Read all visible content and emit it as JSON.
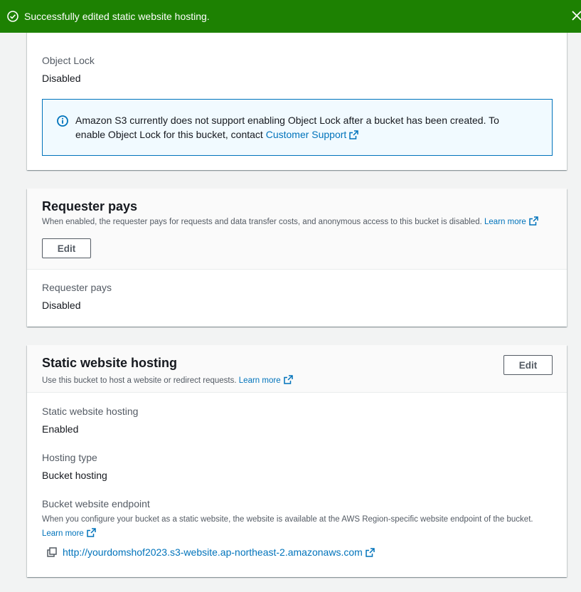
{
  "flash": {
    "message": "Successfully edited static website hosting.",
    "icon": "check-circle-icon",
    "close_icon": "close-icon",
    "color": "#1d8102"
  },
  "object_lock": {
    "label": "Object Lock",
    "value": "Disabled",
    "info_text": "Amazon S3 currently does not support enabling Object Lock after a bucket has been created. To enable Object Lock for this bucket, contact",
    "info_link": "Customer Support"
  },
  "requester_pays": {
    "title": "Requester pays",
    "description": "When enabled, the requester pays for requests and data transfer costs, and anonymous access to this bucket is disabled.",
    "learn_more": "Learn more",
    "edit_label": "Edit",
    "label": "Requester pays",
    "value": "Disabled"
  },
  "static_hosting": {
    "title": "Static website hosting",
    "description": "Use this bucket to host a website or redirect requests.",
    "learn_more": "Learn more",
    "edit_label": "Edit",
    "status_label": "Static website hosting",
    "status_value": "Enabled",
    "type_label": "Hosting type",
    "type_value": "Bucket hosting",
    "endpoint_label": "Bucket website endpoint",
    "endpoint_desc": "When you configure your bucket as a static website, the website is available at the AWS Region-specific website endpoint of the bucket.",
    "endpoint_learn_more": "Learn more",
    "endpoint_url": "http://yourdomshof2023.s3-website.ap-northeast-2.amazonaws.com"
  },
  "colors": {
    "link": "#0073bb",
    "success": "#1d8102",
    "info_border": "#0073bb"
  }
}
